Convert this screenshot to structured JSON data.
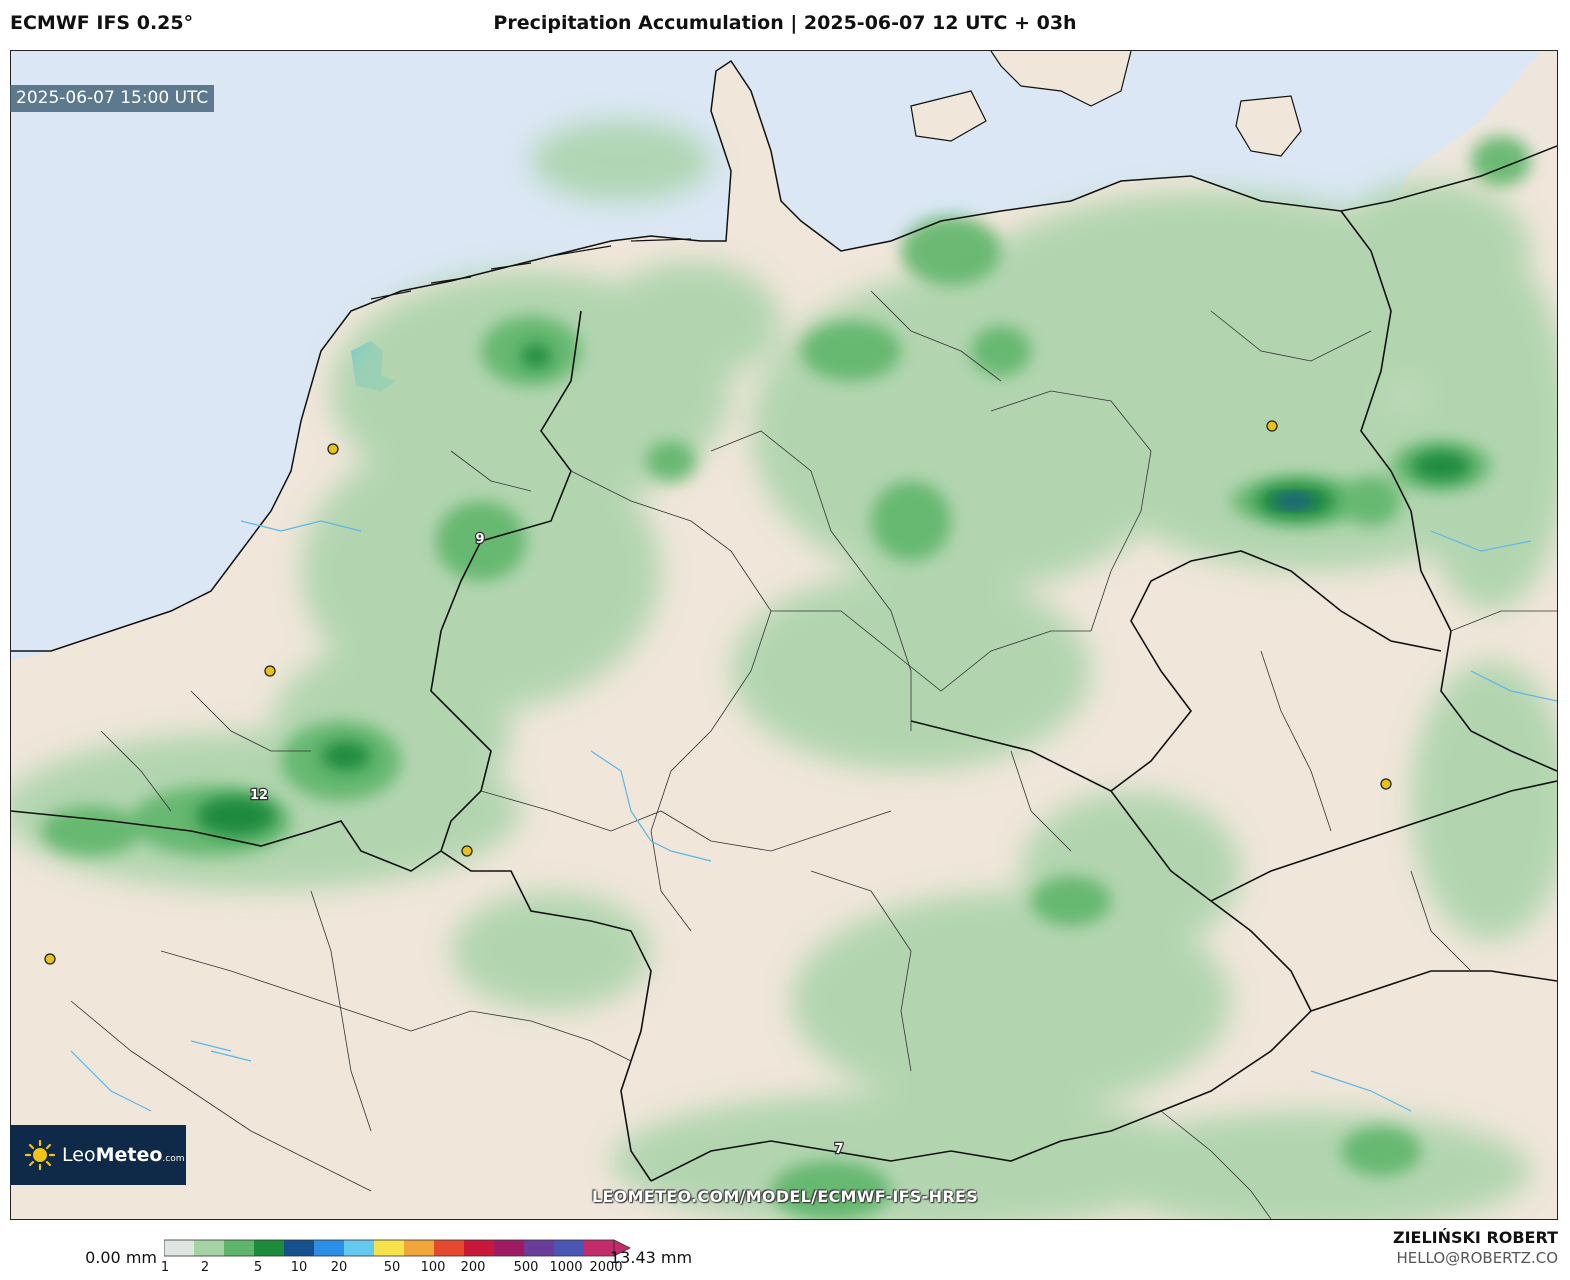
{
  "header": {
    "model": "ECMWF IFS 0.25°",
    "title": "Precipitation Accumulation | 2025-06-07 12 UTC + 03h"
  },
  "map": {
    "valid_time": "2025-06-07 15:00 UTC",
    "watermark": "LEOMETEO.COM/MODEL/ECMWF-IFS-HRES",
    "point_labels": [
      {
        "id": "netherlands-max",
        "value": "9"
      },
      {
        "id": "belgium-max",
        "value": "12"
      },
      {
        "id": "alps-max",
        "value": "7"
      }
    ],
    "colors": {
      "sea": "#dbe7f4",
      "land": "#f0e6da",
      "light_precip": "#c9e3c9",
      "moderate_precip": "#6fbf7a",
      "heavy_precip": "#1f8a3c",
      "extreme_precip": "#1d4fa3",
      "lake": "#4fc4f2",
      "city_marker": "#e8c21a"
    }
  },
  "logo": {
    "text_light": "Leo",
    "text_bold": "Meteo",
    "suffix": ".com"
  },
  "colorbar": {
    "min_label": "0.00 mm",
    "max_label": "13.43 mm",
    "ticks": [
      "1",
      "2",
      "5",
      "10",
      "20",
      "50",
      "100",
      "200",
      "500",
      "1000",
      "2000"
    ],
    "colors": [
      "#dfe5e1",
      "#a6d3a6",
      "#5fb56b",
      "#1e8a3c",
      "#16508c",
      "#2b8fe6",
      "#63c9ee",
      "#f6e24a",
      "#f0a63a",
      "#e3492e",
      "#c9183a",
      "#9e1b63",
      "#6a3d9a",
      "#4b55b3",
      "#c22c6a"
    ]
  },
  "credits": {
    "author": "ZIELIŃSKI ROBERT",
    "email": "HELLO@ROBERTZ.CO"
  }
}
